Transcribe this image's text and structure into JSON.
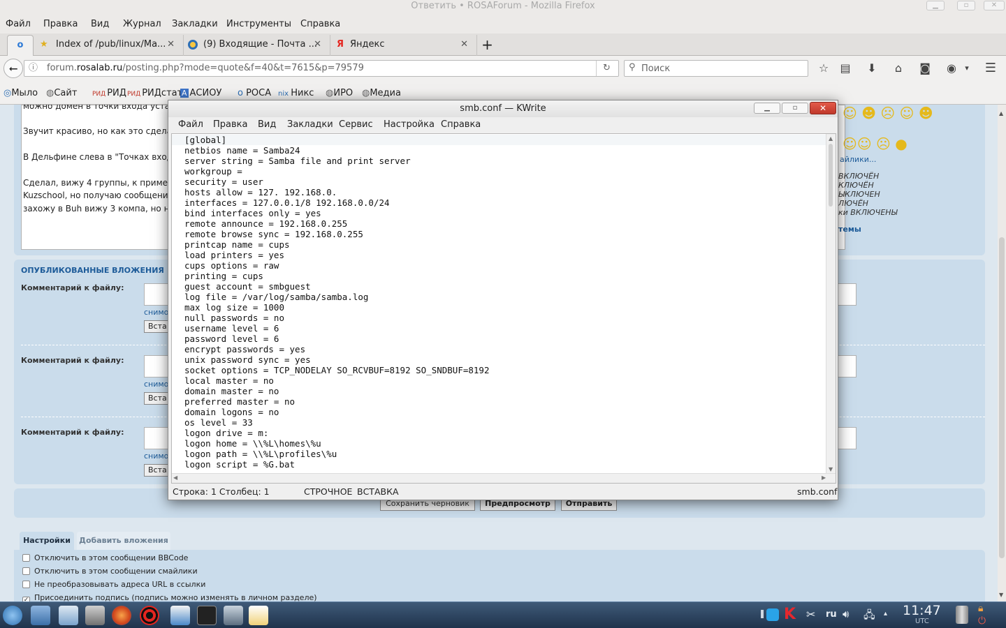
{
  "firefox": {
    "window_title": "Ответить • ROSAForum - Mozilla Firefox",
    "menu": [
      "Файл",
      "Правка",
      "Вид",
      "Журнал",
      "Закладки",
      "Инструменты",
      "Справка"
    ],
    "tabs": [
      {
        "label": "Index of /pub/linux/Ma..."
      },
      {
        "label": "(9) Входящие - Почта ..."
      },
      {
        "label": "Яндекс"
      }
    ],
    "url_host": "forum.",
    "url_domain": "rosalab.ru",
    "url_path": "/posting.php?mode=quote&f=40&t=7615&p=79579",
    "search_placeholder": "Поиск",
    "bookmarks": [
      {
        "label": "Мыло"
      },
      {
        "label": "Сайт"
      },
      {
        "prefix": "РИД",
        "label": "РИД"
      },
      {
        "prefix": "РИД",
        "label": "РИДстат"
      },
      {
        "prefix": "А",
        "label": "АСИОУ"
      },
      {
        "label": "РОСА"
      },
      {
        "label": "Никс"
      },
      {
        "label": "ИРО"
      },
      {
        "label": "Медиа"
      }
    ]
  },
  "forum": {
    "post_lines": [
      "можно домен в точки входа устан",
      "Звучит красиво, но как это сделат",
      "В Дельфине слева в \"Точках входа",
      "Сделал, вижу 4 группы, к пример",
      "Kuzschool, но получаю сообщение",
      "захожу в Buh вижу 3 компа, но ни"
    ],
    "attachments_title": "ОПУБЛИКОВАННЫЕ ВЛОЖЕНИЯ",
    "comment_label": "Комментарий к файлу:",
    "remove_label": "снимо",
    "insert_label": "Вста",
    "smilies_link": "айлики...",
    "status_lines": [
      "ВКЛЮЧЁН",
      "КЛЮЧЁН",
      "ЫКЛЮЧЕН",
      "ЛЮЧЁН",
      "ки ВКЛЮЧЕНЫ"
    ],
    "topic_link": "темы",
    "buttons": {
      "draft": "Сохранить черновик",
      "preview": "Предпросмотр",
      "submit": "Отправить"
    },
    "tabs": [
      "Настройки",
      "Добавить вложения"
    ],
    "options": [
      "Отключить в этом сообщении BBCode",
      "Отключить в этом сообщении смайлики",
      "Не преобразовывать адреса URL в ссылки",
      "Присоединить подпись (подпись можно изменять в личном разделе)"
    ]
  },
  "kwrite": {
    "title": "smb.conf — KWrite",
    "menu": [
      "Файл",
      "Правка",
      "Вид",
      "Закладки",
      "Сервис",
      "Настройка",
      "Справка"
    ],
    "code": "[global]\nnetbios name = Samba24\nserver string = Samba file and print server\nworkgroup =\nsecurity = user\nhosts allow = 127. 192.168.0.\ninterfaces = 127.0.0.1/8 192.168.0.0/24\nbind interfaces only = yes\nremote announce = 192.168.0.255\nremote browse sync = 192.168.0.255\nprintcap name = cups\nload printers = yes\ncups options = raw\nprinting = cups\nguest account = smbguest\nlog file = /var/log/samba/samba.log\nmax log size = 1000\nnull passwords = no\nusername level = 6\npassword level = 6\nencrypt passwords = yes\nunix password sync = yes\nsocket options = TCP_NODELAY SO_RCVBUF=8192 SO_SNDBUF=8192\nlocal master = no\ndomain master = no\npreferred master = no\ndomain logons = no\nos level = 33\nlogon drive = m:\nlogon home = \\\\%L\\homes\\%u\nlogon path = \\\\%L\\profiles\\%u\nlogon script = %G.bat",
    "status_pos": "Строка: 1 Столбец: 1",
    "status_mode": "СТРОЧНОЕ",
    "status_insert": "ВСТАВКА",
    "status_file": "smb.conf"
  },
  "taskbar": {
    "lang": "ru",
    "time": "11:47",
    "tz": "UTC"
  }
}
